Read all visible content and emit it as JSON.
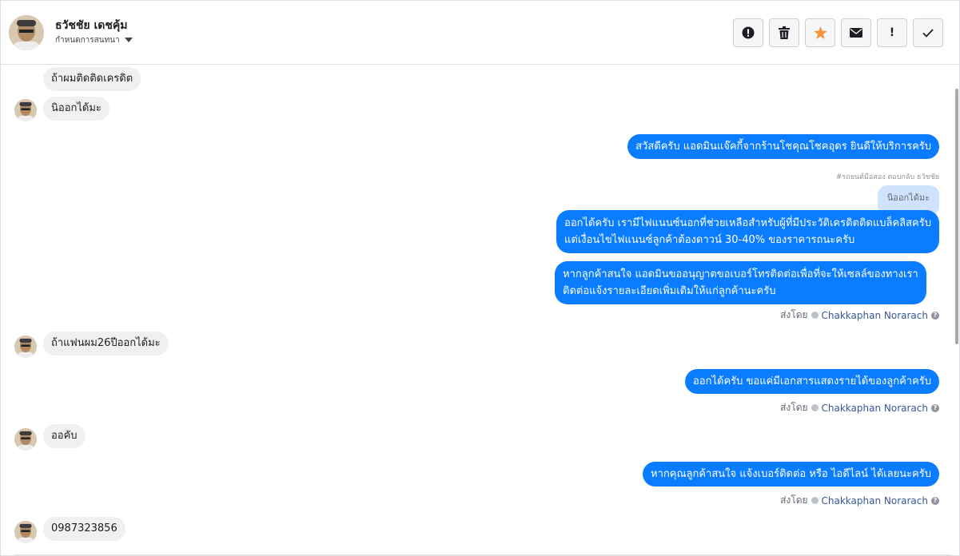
{
  "header": {
    "contact_name": "ธวัชชัย เดชคุ้ม",
    "subtitle": "กำหนดการสนทนา",
    "buttons": {
      "spam": "spam-icon",
      "delete": "trash-icon",
      "star": "star-icon",
      "unread": "envelope-icon",
      "important": "!",
      "done": "check-icon"
    }
  },
  "messages": {
    "in_1": "ถ้าผมติดติดเครดิต",
    "in_2": "นิออกได้มะ",
    "out_1": "สวัสดีครับ แอดมินแจ๊คกี้จากร้านโชคุณโชคอุดร ยินดีให้บริการครับ",
    "reply_note": "#รถยนต์มือสอง ตอบกลับ ธวัชชัย",
    "reply_quote": "นิออกได้มะ",
    "out_2_line1": "ออกได้ครับ เรามีไฟแนนซ์นอกที่ช่วยเหลือสำหรับผู้ที่มีประวัติเครดิตติดแบล็คลิสครับ",
    "out_2_line2": "แต่เงื่อนไขไฟแนนซ์ลูกค้าต้องดาวน์ 30-40% ของราคารถนะครับ",
    "out_3_line1": "หากลูกค้าสนใจ แอดมินขออนุญาตขอเบอร์โทรติดต่อเพื่อที่จะให้เซลล์ของทางเรา",
    "out_3_line2": "ติดต่อแจ้งรายละเอียดเพิ่มเติมให้แก่ลูกค้านะครับ",
    "sent_by_1_label": "ส่งโดย",
    "sent_by_1_agent": "Chakkaphan Norarach",
    "in_3": "ถ้าแฟนผม26ปีออกได้มะ",
    "out_4": "ออกได้ครับ ขอแค่มีเอกสารแสดงรายได้ของลูกค้าครับ",
    "sent_by_2_label": "ส่งโดย",
    "sent_by_2_agent": "Chakkaphan Norarach",
    "in_4": "ออคับ",
    "out_5": "หากคุณลูกค้าสนใจ แจ้งเบอร์ติดต่อ หรือ ไอดีไลน์ ได้เลยนะครับ",
    "sent_by_3_label": "ส่งโดย",
    "sent_by_3_agent": "Chakkaphan Norarach",
    "in_5": "0987323856"
  },
  "colors": {
    "outgoing_bubble": "#0a7cff",
    "incoming_bubble": "#f1f0f0",
    "star": "#f7923a"
  }
}
